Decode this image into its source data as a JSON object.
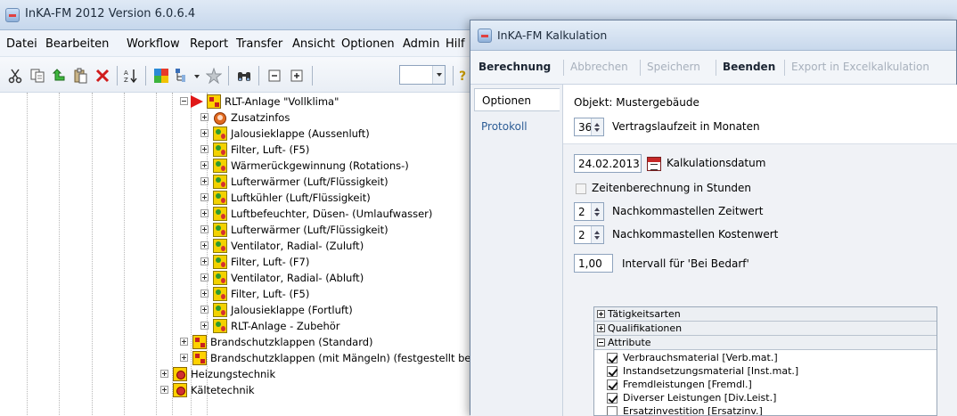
{
  "main_window": {
    "title": "InKA-FM 2012 Version 6.0.6.4"
  },
  "menu": [
    "Datei",
    "Bearbeiten",
    "Workflow",
    "Report",
    "Transfer",
    "Ansicht",
    "Optionen",
    "Admin",
    "Hilf"
  ],
  "tree": {
    "root": "RLT-Anlage \"Vollklima\"",
    "children": [
      "Zusatzinfos",
      "Jalousieklappe (Aussenluft)",
      "Filter, Luft- (F5)",
      "Wärmerückgewinnung (Rotations-)",
      "Lufterwärmer (Luft/Flüssigkeit)",
      "Luftkühler (Luft/Flüssigkeit)",
      "Luftbefeuchter, Düsen- (Umlaufwasser)",
      "Lufterwärmer (Luft/Flüssigkeit)",
      "Ventilator, Radial- (Zuluft)",
      "Filter, Luft- (F7)",
      "Ventilator, Radial- (Abluft)",
      "Filter, Luft- (F5)",
      "Jalousieklappe (Fortluft)",
      "RLT-Anlage - Zubehör"
    ],
    "siblings": [
      "Brandschutzklappen (Standard)",
      "Brandschutzklappen (mit Mängeln) (festgestellt be"
    ],
    "top": [
      "Heizungstechnik",
      "Kältetechnik"
    ]
  },
  "dialog": {
    "title": "InKA-FM Kalkulation",
    "toolbar": {
      "berechnung": "Berechnung",
      "abbrechen": "Abbrechen",
      "speichern": "Speichern",
      "beenden": "Beenden",
      "export": "Export in Excelkalkulation"
    },
    "tabs": {
      "optionen": "Optionen",
      "protokoll": "Protokoll"
    },
    "objekt": "Objekt: Mustergebäude",
    "vertragslaufzeit": {
      "value": "36",
      "label": "Vertragslaufzeit in Monaten"
    },
    "kalkulationsdatum": {
      "value": "24.02.2013",
      "label": "Kalkulationsdatum"
    },
    "zeitenberechnung": {
      "label": "Zeitenberechnung in Stunden",
      "checked": false
    },
    "nk_zeit": {
      "value": "2",
      "label": "Nachkommastellen Zeitwert"
    },
    "nk_kosten": {
      "value": "2",
      "label": "Nachkommastellen Kostenwert"
    },
    "intervall": {
      "value": "1,00",
      "label": "Intervall für 'Bei Bedarf'"
    },
    "groups": {
      "taetigkeitsarten": "Tätigkeitsarten",
      "qualifikationen": "Qualifikationen",
      "attribute": "Attribute"
    },
    "attributes": [
      {
        "label": "Verbrauchsmaterial [Verb.mat.]",
        "checked": true
      },
      {
        "label": "Instandsetzungsmaterial [Inst.mat.]",
        "checked": true
      },
      {
        "label": "Fremdleistungen [Fremdl.]",
        "checked": true
      },
      {
        "label": "Diverser Leistungen [Div.Leist.]",
        "checked": true
      },
      {
        "label": "Ersatzinvestition [Ersatzinv.]",
        "checked": false
      }
    ]
  }
}
